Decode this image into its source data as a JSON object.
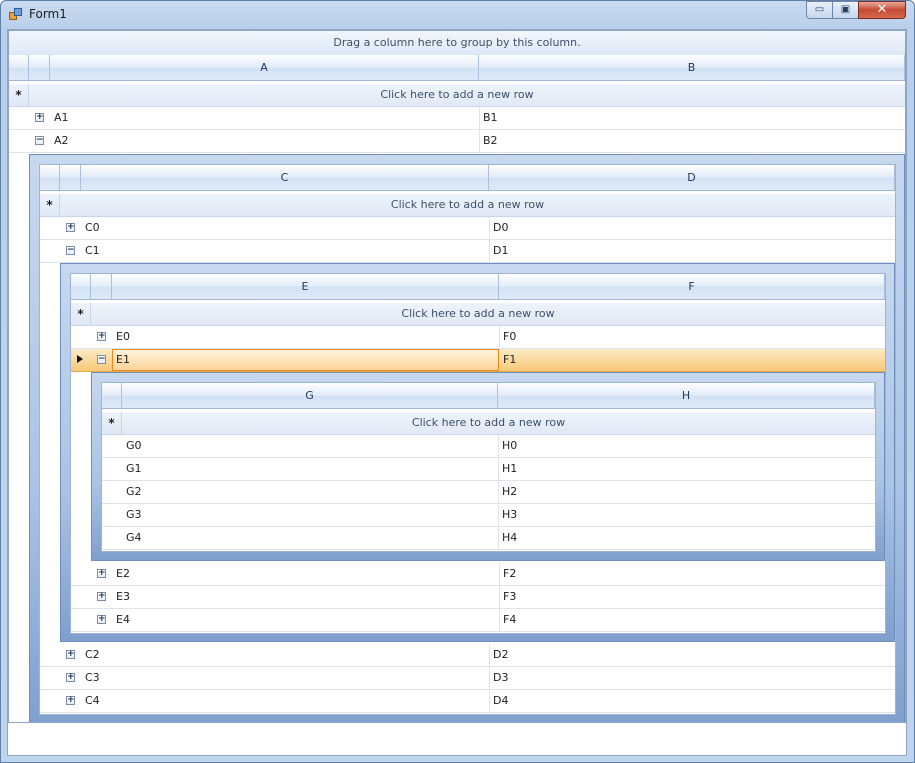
{
  "window": {
    "title": "Form1",
    "min_label": "▭",
    "max_label": "▣",
    "close_label": "✕"
  },
  "grid": {
    "group_hint": "Drag a column here to group by this column.",
    "new_row_text": "Click here to add a new row",
    "level1": {
      "columns": [
        "A",
        "B"
      ],
      "rows": [
        {
          "a": "A1",
          "b": "B1"
        },
        {
          "a": "A2",
          "b": "B2"
        }
      ]
    },
    "level2": {
      "columns": [
        "C",
        "D"
      ],
      "rows": [
        {
          "a": "C0",
          "b": "D0"
        },
        {
          "a": "C1",
          "b": "D1"
        },
        {
          "a": "C2",
          "b": "D2"
        },
        {
          "a": "C3",
          "b": "D3"
        },
        {
          "a": "C4",
          "b": "D4"
        }
      ]
    },
    "level3": {
      "columns": [
        "E",
        "F"
      ],
      "rows": [
        {
          "a": "E0",
          "b": "F0"
        },
        {
          "a": "E1",
          "b": "F1"
        },
        {
          "a": "E2",
          "b": "F2"
        },
        {
          "a": "E3",
          "b": "F3"
        },
        {
          "a": "E4",
          "b": "F4"
        }
      ]
    },
    "level4": {
      "columns": [
        "G",
        "H"
      ],
      "rows": [
        {
          "a": "G0",
          "b": "H0"
        },
        {
          "a": "G1",
          "b": "H1"
        },
        {
          "a": "G2",
          "b": "H2"
        },
        {
          "a": "G3",
          "b": "H3"
        },
        {
          "a": "G4",
          "b": "H4"
        }
      ]
    }
  },
  "icons": {
    "expand": "plus-box-icon",
    "collapse": "minus-box-icon",
    "new_row": "asterisk-icon",
    "current_row": "triangle-arrow-icon"
  },
  "colors": {
    "selection": "#f7c978",
    "header": "#dfeaf8",
    "detail_frame": "#a9c3e6"
  }
}
